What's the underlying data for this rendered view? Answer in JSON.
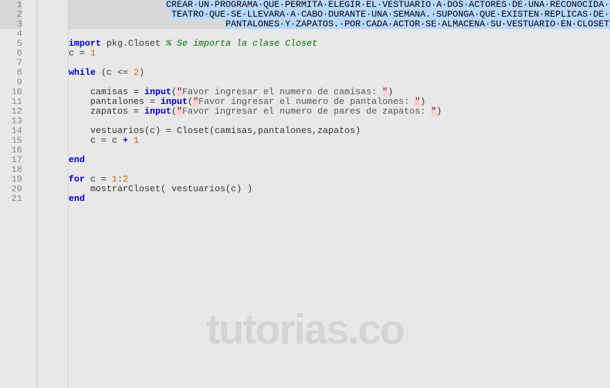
{
  "lines": [
    {
      "n": 1,
      "active": true,
      "seg": [
        {
          "t": "                  ",
          "c": ""
        },
        {
          "t": "CREAR·UN·PROGRAMA·QUE·PERMITA·ELEGIR·EL·VESTUARIO·A·DOS·ACTORES·DE·UNA·RECONOCIDA·OBRA·DE",
          "c": "sel"
        }
      ]
    },
    {
      "n": 2,
      "active": true,
      "seg": [
        {
          "t": "                   ",
          "c": ""
        },
        {
          "t": "TEATRO·QUE·SE·LLEVARA·A·CABO·DURANTE·UNA·SEMANA.·SUPONGA·QUE·EXISTEN·REPLICAS·DE·CAMISAS",
          "c": "sel"
        }
      ]
    },
    {
      "n": 3,
      "active": true,
      "seg": [
        {
          "t": "                             ",
          "c": ""
        },
        {
          "t": "PANTALONES·Y·ZAPATOS.·POR·CADA·ACTOR·SE·ALMACENA·SU·VESTUARIO·EN·CLOSET·APARTE",
          "c": "sel"
        }
      ]
    },
    {
      "n": 4,
      "active": false,
      "seg": [
        {
          "t": "",
          "c": ""
        }
      ]
    },
    {
      "n": 5,
      "active": false,
      "seg": [
        {
          "t": "import",
          "c": "kw"
        },
        {
          "t": " pkg.Closet ",
          "c": ""
        },
        {
          "t": "% Se importa la clase Closet",
          "c": "cmt"
        }
      ]
    },
    {
      "n": 6,
      "active": false,
      "seg": [
        {
          "t": "c = ",
          "c": ""
        },
        {
          "t": "1",
          "c": "num"
        }
      ]
    },
    {
      "n": 7,
      "active": false,
      "seg": [
        {
          "t": "",
          "c": ""
        }
      ]
    },
    {
      "n": 8,
      "active": false,
      "seg": [
        {
          "t": "while",
          "c": "kw"
        },
        {
          "t": " (c <= ",
          "c": ""
        },
        {
          "t": "2",
          "c": "num"
        },
        {
          "t": ")",
          "c": ""
        }
      ]
    },
    {
      "n": 9,
      "active": false,
      "seg": [
        {
          "t": "",
          "c": ""
        }
      ]
    },
    {
      "n": 10,
      "active": false,
      "seg": [
        {
          "t": "    camisas = ",
          "c": ""
        },
        {
          "t": "input",
          "c": "kw"
        },
        {
          "t": "(",
          "c": ""
        },
        {
          "t": "\"",
          "c": "str-bg"
        },
        {
          "t": "Favor ingresar el numero de camisas: ",
          "c": "str"
        },
        {
          "t": "\"",
          "c": "str-bg"
        },
        {
          "t": ")",
          "c": ""
        }
      ]
    },
    {
      "n": 11,
      "active": false,
      "seg": [
        {
          "t": "    pantalones = ",
          "c": ""
        },
        {
          "t": "input",
          "c": "kw"
        },
        {
          "t": "(",
          "c": ""
        },
        {
          "t": "\"",
          "c": "str-bg"
        },
        {
          "t": "Favor ingresar el numero de pantalones: ",
          "c": "str"
        },
        {
          "t": "\"",
          "c": "str-bg"
        },
        {
          "t": ")",
          "c": ""
        }
      ]
    },
    {
      "n": 12,
      "active": false,
      "seg": [
        {
          "t": "    zapatos = ",
          "c": ""
        },
        {
          "t": "input",
          "c": "kw"
        },
        {
          "t": "(",
          "c": ""
        },
        {
          "t": "\"",
          "c": "str-bg"
        },
        {
          "t": "Favor ingresar el numero de pares de zapatos: ",
          "c": "str"
        },
        {
          "t": "\"",
          "c": "str-bg"
        },
        {
          "t": ")",
          "c": ""
        }
      ]
    },
    {
      "n": 13,
      "active": false,
      "seg": [
        {
          "t": "",
          "c": ""
        }
      ]
    },
    {
      "n": 14,
      "active": false,
      "seg": [
        {
          "t": "    vestuarios(c) = Closet(camisas,pantalones,zapatos)",
          "c": ""
        }
      ]
    },
    {
      "n": 15,
      "active": false,
      "seg": [
        {
          "t": "    c = c ",
          "c": ""
        },
        {
          "t": "+",
          "c": "kw"
        },
        {
          "t": " ",
          "c": ""
        },
        {
          "t": "1",
          "c": "num"
        }
      ]
    },
    {
      "n": 16,
      "active": false,
      "seg": [
        {
          "t": "",
          "c": ""
        }
      ]
    },
    {
      "n": 17,
      "active": false,
      "seg": [
        {
          "t": "end",
          "c": "kw"
        }
      ]
    },
    {
      "n": 18,
      "active": false,
      "seg": [
        {
          "t": "",
          "c": ""
        }
      ]
    },
    {
      "n": 19,
      "active": false,
      "seg": [
        {
          "t": "for",
          "c": "kw"
        },
        {
          "t": " c = ",
          "c": ""
        },
        {
          "t": "1",
          "c": "num"
        },
        {
          "t": ":",
          "c": ""
        },
        {
          "t": "2",
          "c": "num"
        }
      ]
    },
    {
      "n": 20,
      "active": false,
      "seg": [
        {
          "t": "    mostrarCloset( vestuarios(c) )",
          "c": ""
        }
      ]
    },
    {
      "n": 21,
      "active": false,
      "seg": [
        {
          "t": "end",
          "c": "kw"
        }
      ]
    }
  ],
  "watermark": "tutorias.co"
}
